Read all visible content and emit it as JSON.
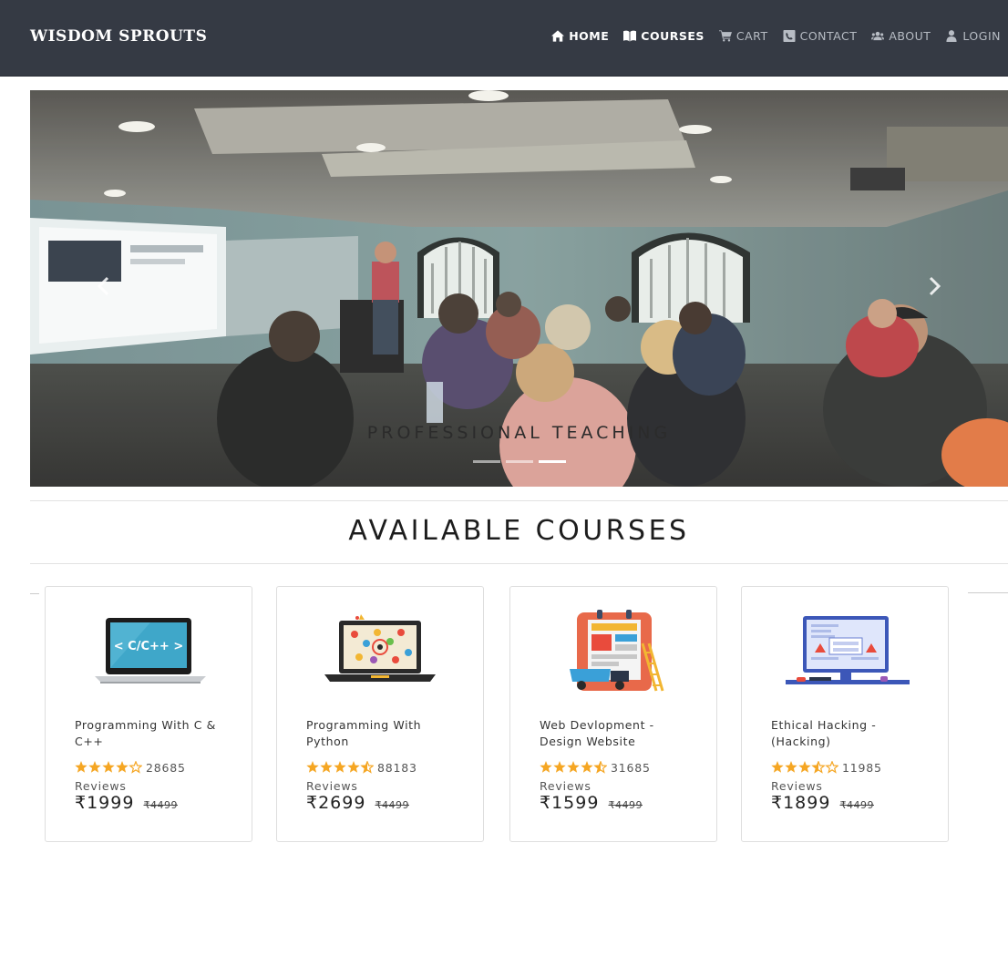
{
  "brand": "WISDOM SPROUTS",
  "nav": [
    {
      "label": "HOME",
      "icon": "home-icon",
      "active": true
    },
    {
      "label": "COURSES",
      "icon": "book-icon",
      "active": true
    },
    {
      "label": "CART",
      "icon": "cart-icon",
      "active": false
    },
    {
      "label": "CONTACT",
      "icon": "phone-icon",
      "active": false
    },
    {
      "label": "ABOUT",
      "icon": "users-icon",
      "active": false
    },
    {
      "label": "LOGIN",
      "icon": "user-icon",
      "active": false
    }
  ],
  "carousel": {
    "caption": "PROFESSIONAL TEACHING",
    "indicators": 3,
    "active_indicator": 3,
    "prev_icon": "chevron-left-icon",
    "next_icon": "chevron-right-icon"
  },
  "section_title": "AVAILABLE COURSES",
  "courses": [
    {
      "title": "Programming With C & C++",
      "rating": 4,
      "reviews_count": "28685",
      "reviews_label": "Reviews",
      "price": "₹1999",
      "old_price": "₹4499",
      "thumb": "c-cpp-laptop-icon",
      "thumb_text": "< C/C++ >"
    },
    {
      "title": "Programming With Python",
      "rating": 4.5,
      "reviews_count": "88183",
      "reviews_label": "Reviews",
      "price": "₹2699",
      "old_price": "₹4499",
      "thumb": "python-laptop-icon"
    },
    {
      "title": "Web Devlopment - Design Website",
      "rating": 4.5,
      "reviews_count": "31685",
      "reviews_label": "Reviews",
      "price": "₹1599",
      "old_price": "₹4499",
      "thumb": "web-design-icon"
    },
    {
      "title": "Ethical Hacking - (Hacking)",
      "rating": 3.5,
      "reviews_count": "11985",
      "reviews_label": "Reviews",
      "price": "₹1899",
      "old_price": "₹4499",
      "thumb": "hacking-monitor-icon"
    }
  ],
  "colors": {
    "navbar_bg": "#353a44",
    "nav_text": "#b7bcc4",
    "star": "#f5a623",
    "card_border": "#dedede"
  }
}
